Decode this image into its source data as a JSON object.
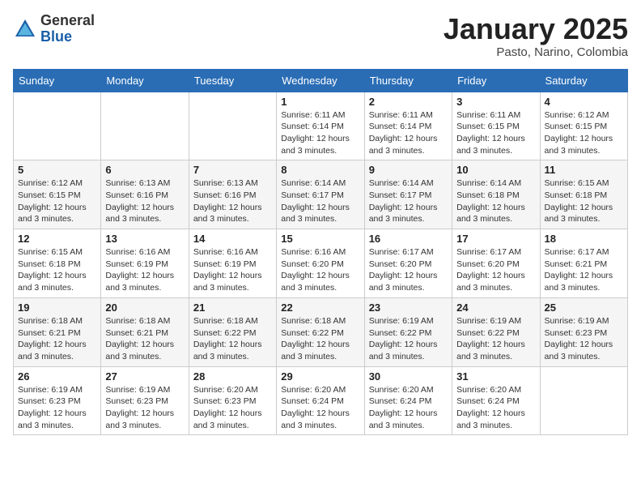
{
  "header": {
    "logo_general": "General",
    "logo_blue": "Blue",
    "month": "January 2025",
    "location": "Pasto, Narino, Colombia"
  },
  "weekdays": [
    "Sunday",
    "Monday",
    "Tuesday",
    "Wednesday",
    "Thursday",
    "Friday",
    "Saturday"
  ],
  "weeks": [
    [
      {
        "day": "",
        "detail": ""
      },
      {
        "day": "",
        "detail": ""
      },
      {
        "day": "",
        "detail": ""
      },
      {
        "day": "1",
        "detail": "Sunrise: 6:11 AM\nSunset: 6:14 PM\nDaylight: 12 hours\nand 3 minutes."
      },
      {
        "day": "2",
        "detail": "Sunrise: 6:11 AM\nSunset: 6:14 PM\nDaylight: 12 hours\nand 3 minutes."
      },
      {
        "day": "3",
        "detail": "Sunrise: 6:11 AM\nSunset: 6:15 PM\nDaylight: 12 hours\nand 3 minutes."
      },
      {
        "day": "4",
        "detail": "Sunrise: 6:12 AM\nSunset: 6:15 PM\nDaylight: 12 hours\nand 3 minutes."
      }
    ],
    [
      {
        "day": "5",
        "detail": "Sunrise: 6:12 AM\nSunset: 6:15 PM\nDaylight: 12 hours\nand 3 minutes."
      },
      {
        "day": "6",
        "detail": "Sunrise: 6:13 AM\nSunset: 6:16 PM\nDaylight: 12 hours\nand 3 minutes."
      },
      {
        "day": "7",
        "detail": "Sunrise: 6:13 AM\nSunset: 6:16 PM\nDaylight: 12 hours\nand 3 minutes."
      },
      {
        "day": "8",
        "detail": "Sunrise: 6:14 AM\nSunset: 6:17 PM\nDaylight: 12 hours\nand 3 minutes."
      },
      {
        "day": "9",
        "detail": "Sunrise: 6:14 AM\nSunset: 6:17 PM\nDaylight: 12 hours\nand 3 minutes."
      },
      {
        "day": "10",
        "detail": "Sunrise: 6:14 AM\nSunset: 6:18 PM\nDaylight: 12 hours\nand 3 minutes."
      },
      {
        "day": "11",
        "detail": "Sunrise: 6:15 AM\nSunset: 6:18 PM\nDaylight: 12 hours\nand 3 minutes."
      }
    ],
    [
      {
        "day": "12",
        "detail": "Sunrise: 6:15 AM\nSunset: 6:18 PM\nDaylight: 12 hours\nand 3 minutes."
      },
      {
        "day": "13",
        "detail": "Sunrise: 6:16 AM\nSunset: 6:19 PM\nDaylight: 12 hours\nand 3 minutes."
      },
      {
        "day": "14",
        "detail": "Sunrise: 6:16 AM\nSunset: 6:19 PM\nDaylight: 12 hours\nand 3 minutes."
      },
      {
        "day": "15",
        "detail": "Sunrise: 6:16 AM\nSunset: 6:20 PM\nDaylight: 12 hours\nand 3 minutes."
      },
      {
        "day": "16",
        "detail": "Sunrise: 6:17 AM\nSunset: 6:20 PM\nDaylight: 12 hours\nand 3 minutes."
      },
      {
        "day": "17",
        "detail": "Sunrise: 6:17 AM\nSunset: 6:20 PM\nDaylight: 12 hours\nand 3 minutes."
      },
      {
        "day": "18",
        "detail": "Sunrise: 6:17 AM\nSunset: 6:21 PM\nDaylight: 12 hours\nand 3 minutes."
      }
    ],
    [
      {
        "day": "19",
        "detail": "Sunrise: 6:18 AM\nSunset: 6:21 PM\nDaylight: 12 hours\nand 3 minutes."
      },
      {
        "day": "20",
        "detail": "Sunrise: 6:18 AM\nSunset: 6:21 PM\nDaylight: 12 hours\nand 3 minutes."
      },
      {
        "day": "21",
        "detail": "Sunrise: 6:18 AM\nSunset: 6:22 PM\nDaylight: 12 hours\nand 3 minutes."
      },
      {
        "day": "22",
        "detail": "Sunrise: 6:18 AM\nSunset: 6:22 PM\nDaylight: 12 hours\nand 3 minutes."
      },
      {
        "day": "23",
        "detail": "Sunrise: 6:19 AM\nSunset: 6:22 PM\nDaylight: 12 hours\nand 3 minutes."
      },
      {
        "day": "24",
        "detail": "Sunrise: 6:19 AM\nSunset: 6:22 PM\nDaylight: 12 hours\nand 3 minutes."
      },
      {
        "day": "25",
        "detail": "Sunrise: 6:19 AM\nSunset: 6:23 PM\nDaylight: 12 hours\nand 3 minutes."
      }
    ],
    [
      {
        "day": "26",
        "detail": "Sunrise: 6:19 AM\nSunset: 6:23 PM\nDaylight: 12 hours\nand 3 minutes."
      },
      {
        "day": "27",
        "detail": "Sunrise: 6:19 AM\nSunset: 6:23 PM\nDaylight: 12 hours\nand 3 minutes."
      },
      {
        "day": "28",
        "detail": "Sunrise: 6:20 AM\nSunset: 6:23 PM\nDaylight: 12 hours\nand 3 minutes."
      },
      {
        "day": "29",
        "detail": "Sunrise: 6:20 AM\nSunset: 6:24 PM\nDaylight: 12 hours\nand 3 minutes."
      },
      {
        "day": "30",
        "detail": "Sunrise: 6:20 AM\nSunset: 6:24 PM\nDaylight: 12 hours\nand 3 minutes."
      },
      {
        "day": "31",
        "detail": "Sunrise: 6:20 AM\nSunset: 6:24 PM\nDaylight: 12 hours\nand 3 minutes."
      },
      {
        "day": "",
        "detail": ""
      }
    ]
  ]
}
